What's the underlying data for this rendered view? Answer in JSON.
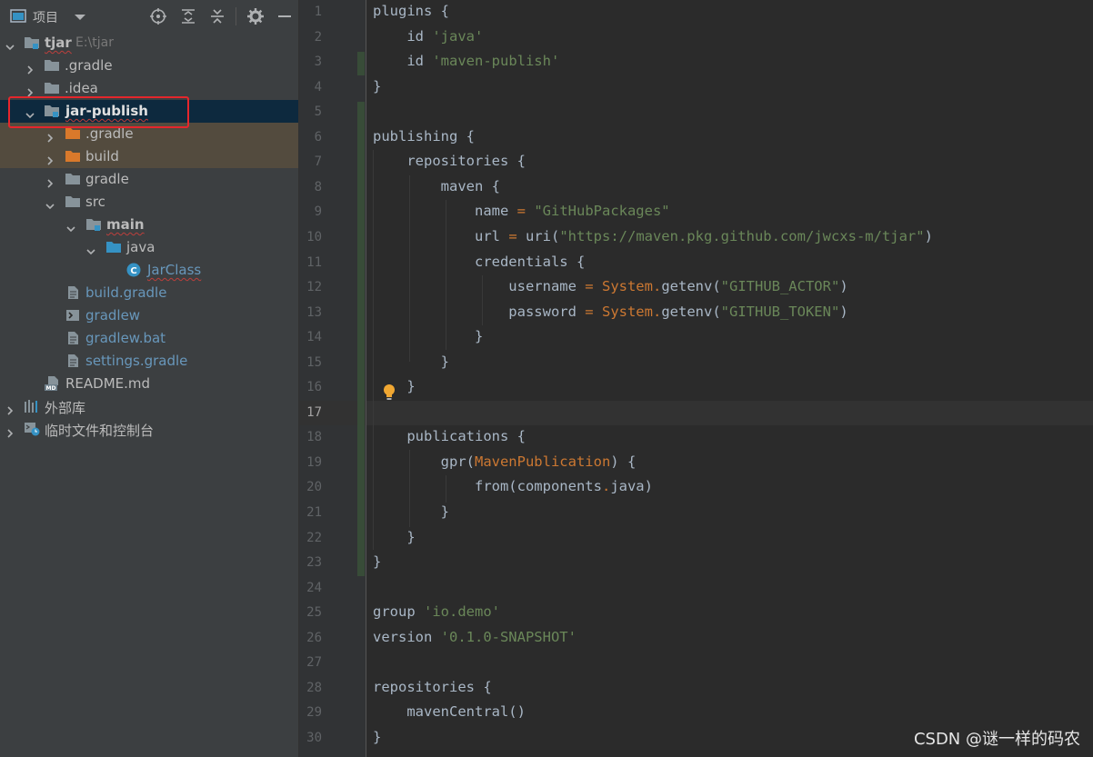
{
  "project_panel": {
    "title": "项目",
    "tree": [
      {
        "label": "tjar",
        "path": "E:\\tjar",
        "indent": 0
      },
      {
        "label": ".gradle",
        "indent": 1
      },
      {
        "label": ".idea",
        "indent": 1
      },
      {
        "label": "jar-publish",
        "indent": 1
      },
      {
        "label": ".gradle",
        "indent": 2
      },
      {
        "label": "build",
        "indent": 2
      },
      {
        "label": "gradle",
        "indent": 2
      },
      {
        "label": "src",
        "indent": 2
      },
      {
        "label": "main",
        "indent": 3
      },
      {
        "label": "java",
        "indent": 4
      },
      {
        "label": "JarClass",
        "indent": 5
      },
      {
        "label": "build.gradle",
        "indent": 2
      },
      {
        "label": "gradlew",
        "indent": 2
      },
      {
        "label": "gradlew.bat",
        "indent": 2
      },
      {
        "label": "settings.gradle",
        "indent": 2
      },
      {
        "label": "README.md",
        "indent": 1
      },
      {
        "label": "外部库",
        "indent": 0
      },
      {
        "label": "临时文件和控制台",
        "indent": 0
      }
    ]
  },
  "editor": {
    "current_line": 17,
    "line_numbers": [
      "1",
      "2",
      "3",
      "4",
      "5",
      "6",
      "7",
      "8",
      "9",
      "10",
      "11",
      "12",
      "13",
      "14",
      "15",
      "16",
      "17",
      "18",
      "19",
      "20",
      "21",
      "22",
      "23",
      "24",
      "25",
      "26",
      "27",
      "28",
      "29",
      "30"
    ],
    "lines": [
      "plugins {",
      "    id 'java'",
      "    id 'maven-publish'",
      "}",
      "",
      "publishing {",
      "    repositories {",
      "        maven {",
      "            name = \"GitHubPackages\"",
      "            url = uri(\"https://maven.pkg.github.com/jwcxs-m/tjar\")",
      "            credentials {",
      "                username = System.getenv(\"GITHUB_ACTOR\")",
      "                password = System.getenv(\"GITHUB_TOKEN\")",
      "            }",
      "        }",
      "    }",
      "",
      "    publications {",
      "        gpr(MavenPublication) {",
      "            from(components.java)",
      "        }",
      "    }",
      "}",
      "",
      "group 'io.demo'",
      "version '0.1.0-SNAPSHOT'",
      "",
      "repositories {",
      "    mavenCentral()",
      "}"
    ]
  },
  "watermark": "CSDN @谜一样的码农",
  "colors": {
    "panel_bg": "#3c3f41",
    "editor_bg": "#2b2b2b",
    "selection": "#0d293e",
    "annotation_box": "#e5262c",
    "string": "#6a8759",
    "keyword": "#cc7832"
  }
}
